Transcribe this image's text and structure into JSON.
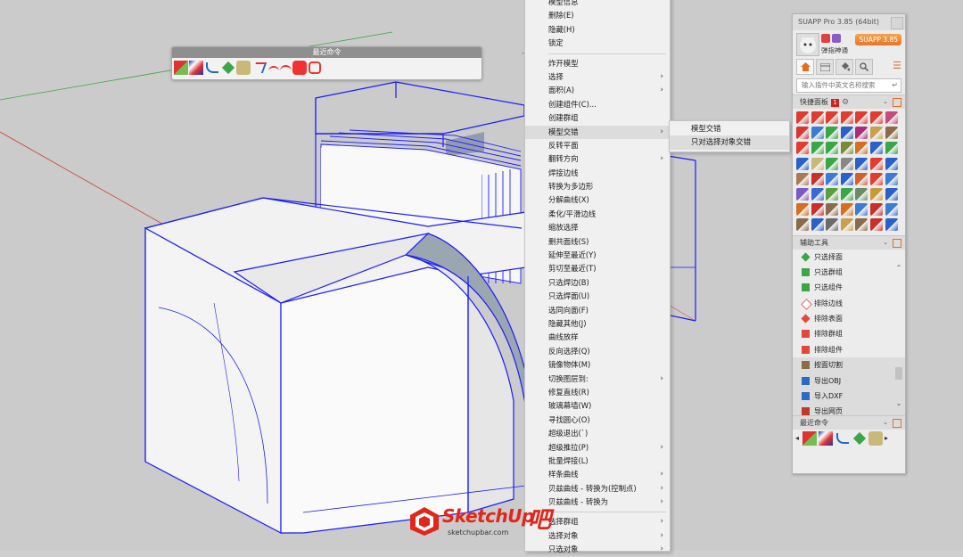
{
  "recent_toolbar": {
    "title": "最近命令"
  },
  "context_menu": {
    "items": [
      {
        "label": "模型信息",
        "submenu": false
      },
      {
        "label": "删除(E)",
        "submenu": false
      },
      {
        "label": "隐藏(H)",
        "submenu": false
      },
      {
        "label": "锁定",
        "submenu": false
      },
      {
        "sep": true
      },
      {
        "label": "炸开模型",
        "submenu": false
      },
      {
        "label": "选择",
        "submenu": true
      },
      {
        "label": "面积(A)",
        "submenu": true
      },
      {
        "label": "创建组件(C)...",
        "submenu": false
      },
      {
        "label": "创建群组",
        "submenu": false
      },
      {
        "label": "模型交错",
        "submenu": true,
        "hover": true
      },
      {
        "label": "反转平面",
        "submenu": false
      },
      {
        "label": "翻转方向",
        "submenu": true
      },
      {
        "label": "焊接边线",
        "submenu": false
      },
      {
        "label": "转换为多边形",
        "submenu": false
      },
      {
        "label": "分解曲线(X)",
        "submenu": false
      },
      {
        "label": "柔化/平滑边线",
        "submenu": false
      },
      {
        "label": "缩放选择",
        "submenu": false
      },
      {
        "label": "删共面线(S)",
        "submenu": false
      },
      {
        "label": "延伸至最近(Y)",
        "submenu": false
      },
      {
        "label": "剪切至最近(T)",
        "submenu": false
      },
      {
        "label": "只选焊边(B)",
        "submenu": false
      },
      {
        "label": "只选焊面(U)",
        "submenu": false
      },
      {
        "label": "选同向面(F)",
        "submenu": false
      },
      {
        "label": "隐藏其他(J)",
        "submenu": false
      },
      {
        "label": "曲线放样",
        "submenu": false
      },
      {
        "label": "反向选择(Q)",
        "submenu": false
      },
      {
        "label": "镜像物体(M)",
        "submenu": false
      },
      {
        "label": "切换图层到:",
        "submenu": true
      },
      {
        "label": "修复直线(R)",
        "submenu": false
      },
      {
        "label": "玻璃幕墙(W)",
        "submenu": false
      },
      {
        "label": "寻找圆心(O)",
        "submenu": false
      },
      {
        "label": "超级退出(`)",
        "submenu": false
      },
      {
        "label": "超级推拉(P)",
        "submenu": true
      },
      {
        "label": "批量焊接(L)",
        "submenu": false
      },
      {
        "label": "样条曲线",
        "submenu": true
      },
      {
        "label": "贝兹曲线 - 转换为(控制点)",
        "submenu": true
      },
      {
        "label": "贝兹曲线 - 转换为",
        "submenu": true
      },
      {
        "sep": true
      },
      {
        "label": "选择群组",
        "submenu": true
      },
      {
        "label": "选择对象",
        "submenu": true
      },
      {
        "label": "只选对象",
        "submenu": true
      }
    ]
  },
  "submenu": {
    "items": [
      {
        "label": "模型交错"
      },
      {
        "label": "只对选择对象交错",
        "hover": true
      }
    ]
  },
  "suapp": {
    "title": "SUAPP Pro 3.85 (64bit)",
    "username": "弹指神通",
    "badge": "SUAPP 3.85",
    "search_placeholder": "输入插件中英文名称搜索",
    "quick_panel": {
      "label": "快捷面板",
      "badge": "1"
    },
    "aux_tools": {
      "label": "辅助工具",
      "items": [
        {
          "label": "只选择面",
          "icon": "diamond-green-icon",
          "color": "#3aa648"
        },
        {
          "label": "只选群组",
          "icon": "cube-green-icon",
          "color": "#3aa648"
        },
        {
          "label": "只选组件",
          "icon": "component-green-icon",
          "color": "#3aa648"
        },
        {
          "label": "排除边线",
          "icon": "diamond-red-outline-icon",
          "color": "#e04a3a"
        },
        {
          "label": "排除表面",
          "icon": "diamond-red-icon",
          "color": "#e04a3a"
        },
        {
          "label": "排除群组",
          "icon": "cube-red-icon",
          "color": "#e04a3a"
        },
        {
          "label": "排除组件",
          "icon": "component-red-icon",
          "color": "#e04a3a"
        },
        {
          "label": "按面切割",
          "icon": "cut-face-icon",
          "color": "#8a6b4a"
        },
        {
          "label": "导出OBJ",
          "icon": "obj-export-icon",
          "color": "#2a6bc4"
        },
        {
          "label": "导入DXF",
          "icon": "dxf-import-icon",
          "color": "#2a6bc4"
        },
        {
          "label": "导出网页",
          "icon": "web-export-icon",
          "color": "#c0392b"
        }
      ]
    },
    "recent_cmds": {
      "label": "最近命令"
    }
  },
  "watermark": {
    "brand": "SketchUp",
    "suffix": "吧",
    "url": "sketchupbar.com"
  },
  "colors": {
    "model_edge": "#1a1aff",
    "axis_red": "#c8402f",
    "axis_green": "#3aa648",
    "brand_orange": "#e7742a",
    "watermark_red": "#e1261c"
  }
}
